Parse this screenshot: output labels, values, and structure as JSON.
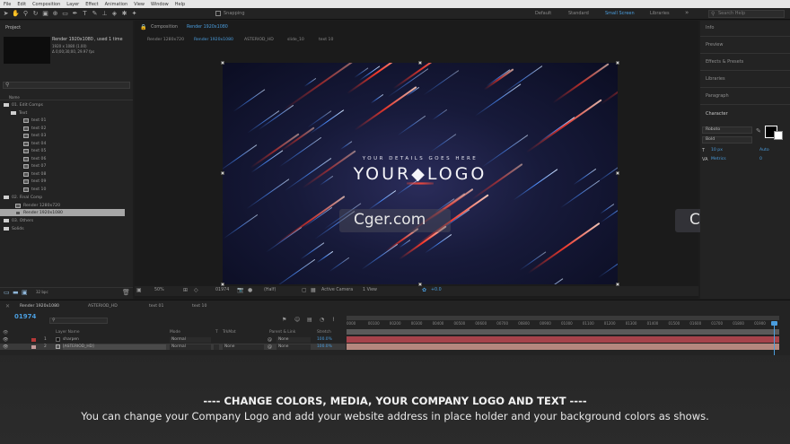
{
  "menu": [
    "File",
    "Edit",
    "Composition",
    "Layer",
    "Effect",
    "Animation",
    "View",
    "Window",
    "Help"
  ],
  "toolbar": {
    "snapping": "Snapping",
    "workspaces": [
      "Default",
      "Standard",
      "Small Screen",
      "Libraries"
    ],
    "search_placeholder": "Search Help"
  },
  "project": {
    "title": "Project",
    "comp_name": "Render 1920x1080",
    "used": ", used 1 time",
    "info1": "1920 x 1080 (1.00)",
    "info2": "Δ 0;00;30;00, 29.97 fps",
    "col_name": "Name",
    "items": [
      "01. Edit Comps",
      "Text",
      "text 01",
      "text 02",
      "text 03",
      "text 04",
      "text 05",
      "text 06",
      "text 07",
      "text 08",
      "text 09",
      "text 10",
      "02. Final Comp",
      "Render 1280x720",
      "Render 1920x1080",
      "03. Others",
      "Solids"
    ],
    "bpc": "32 bpc"
  },
  "composition": {
    "panel_label": "Composition",
    "panel_comp": "Render 1920x1080",
    "tabs": [
      "Render 1280x720",
      "Render 1920x1080",
      "ASTERIOD_HD",
      "slide_10",
      "text 10"
    ],
    "tagline": "YOUR DETAILS GOES HERE",
    "logo": "YOUR◆LOGO",
    "zoom": "50%",
    "timecode": "01974",
    "resolution": "(Half)",
    "camera": "Active Camera",
    "views": "1 View",
    "offset": "+0.0"
  },
  "right_panels": [
    "Info",
    "Preview",
    "Effects & Presets",
    "Libraries",
    "Paragraph",
    "Character"
  ],
  "character": {
    "font": "Roboto",
    "style": "Bold",
    "size": "10 px",
    "leading": "Auto",
    "tracking": "0",
    "kerning": "Metrics"
  },
  "timeline": {
    "tabs": [
      "Render 1920x1080",
      "ASTERIOD_HD",
      "text 01",
      "text 10"
    ],
    "timecode": "01974",
    "headers": [
      "Layer Name",
      "Mode",
      "T",
      "TrkMat",
      "Parent & Link",
      "Stretch"
    ],
    "layers": [
      {
        "num": "1",
        "name": "sharpen",
        "mode": "Normal",
        "trk": "",
        "parent": "None",
        "stretch": "100.0%"
      },
      {
        "num": "2",
        "name": "[ASTERIOD_HD]",
        "mode": "Normal",
        "trk": "None",
        "parent": "None",
        "stretch": "100.0%"
      }
    ],
    "ticks": [
      "0000",
      "00100",
      "00200",
      "00300",
      "00400",
      "00500",
      "00600",
      "00700",
      "00800",
      "00900",
      "01000",
      "01100",
      "01200",
      "01300",
      "01400",
      "01500",
      "01600",
      "01700",
      "01800",
      "01900"
    ]
  },
  "watermark": "Cger.com",
  "caption": {
    "line1": "---- CHANGE COLORS, MEDIA, YOUR COMPANY LOGO AND TEXT ----",
    "line2": "You can change your Company Logo and add your website address in place holder and your background colors as shows."
  }
}
